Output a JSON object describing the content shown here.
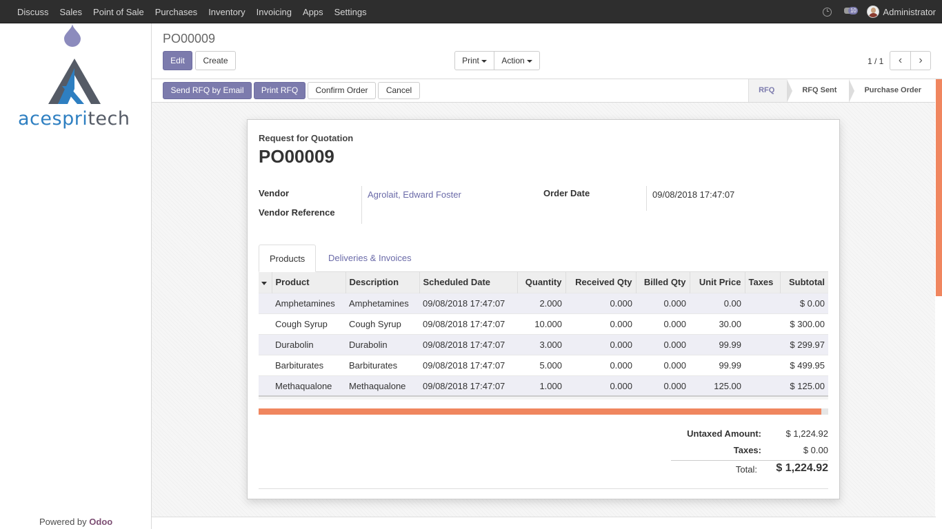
{
  "topbar": {
    "menu": [
      "Discuss",
      "Sales",
      "Point of Sale",
      "Purchases",
      "Inventory",
      "Invoicing",
      "Apps",
      "Settings"
    ],
    "messages_count": "10",
    "user": "Administrator"
  },
  "sidebar": {
    "logo_part1": "acespri",
    "logo_part2": "tech",
    "powered_by": "Powered by",
    "powered_brand": "Odoo"
  },
  "control_panel": {
    "breadcrumb": "PO00009",
    "edit": "Edit",
    "create": "Create",
    "print": "Print",
    "action": "Action",
    "pager": "1 / 1"
  },
  "header_buttons": {
    "send_rfq": "Send RFQ by Email",
    "print_rfq": "Print RFQ",
    "confirm": "Confirm Order",
    "cancel": "Cancel"
  },
  "statusbar": [
    "RFQ",
    "RFQ Sent",
    "Purchase Order"
  ],
  "form": {
    "doc_label": "Request for Quotation",
    "doc_name": "PO00009",
    "vendor_label": "Vendor",
    "vendor_value": "Agrolait, Edward Foster",
    "vendor_ref_label": "Vendor Reference",
    "order_date_label": "Order Date",
    "order_date_value": "09/08/2018 17:47:07"
  },
  "tabs": [
    "Products",
    "Deliveries & Invoices"
  ],
  "table": {
    "headers": [
      "Product",
      "Description",
      "Scheduled Date",
      "Quantity",
      "Received Qty",
      "Billed Qty",
      "Unit Price",
      "Taxes",
      "Subtotal"
    ],
    "rows": [
      [
        "Amphetamines",
        "Amphetamines",
        "09/08/2018 17:47:07",
        "2.000",
        "0.000",
        "0.000",
        "0.00",
        "",
        "$ 0.00"
      ],
      [
        "Cough Syrup",
        "Cough Syrup",
        "09/08/2018 17:47:07",
        "10.000",
        "0.000",
        "0.000",
        "30.00",
        "",
        "$ 300.00"
      ],
      [
        "Durabolin",
        "Durabolin",
        "09/08/2018 17:47:07",
        "3.000",
        "0.000",
        "0.000",
        "99.99",
        "",
        "$ 299.97"
      ],
      [
        "Barbiturates",
        "Barbiturates",
        "09/08/2018 17:47:07",
        "5.000",
        "0.000",
        "0.000",
        "99.99",
        "",
        "$ 499.95"
      ],
      [
        "Methaqualone",
        "Methaqualone",
        "09/08/2018 17:47:07",
        "1.000",
        "0.000",
        "0.000",
        "125.00",
        "",
        "$ 125.00"
      ]
    ]
  },
  "totals": {
    "untaxed_label": "Untaxed Amount:",
    "untaxed_value": "$ 1,224.92",
    "taxes_label": "Taxes:",
    "taxes_value": "$ 0.00",
    "total_label": "Total:",
    "total_value": "$ 1,224.92"
  },
  "colors": {
    "primary": "#7c7bad",
    "topbar": "#2e2e2e",
    "accent_scroll": "#f0865f",
    "link": "#6a6aa8"
  }
}
